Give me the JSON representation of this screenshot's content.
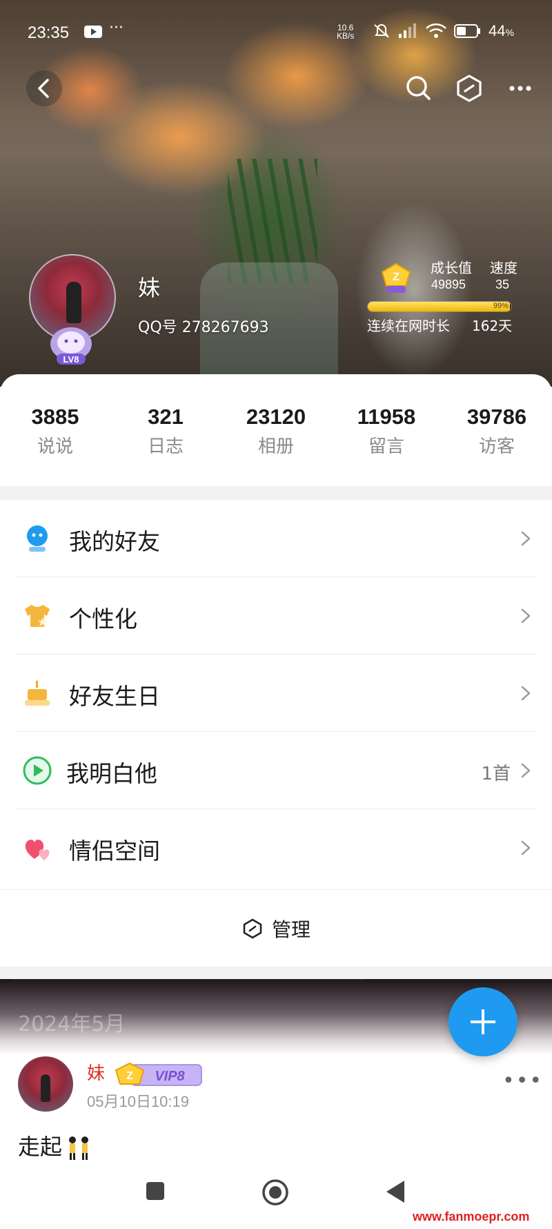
{
  "status_bar": {
    "time": "23:35",
    "network_speed_value": "10.6",
    "network_speed_unit": "KB/s",
    "battery": "44"
  },
  "profile": {
    "nickname": "妹",
    "qq_number": "QQ号 278267693",
    "level_badge": "LV8",
    "growth_label": "成长值",
    "speed_label": "速度",
    "growth_value": "49895",
    "speed_value": "35",
    "progress_percent": 99,
    "progress_text": "99%",
    "online_label": "连续在网时长",
    "online_days": "162天"
  },
  "stats": [
    {
      "value": "3885",
      "label": "说说"
    },
    {
      "value": "321",
      "label": "日志"
    },
    {
      "value": "23120",
      "label": "相册"
    },
    {
      "value": "11958",
      "label": "留言"
    },
    {
      "value": "39786",
      "label": "访客"
    }
  ],
  "menu": {
    "items": [
      {
        "label": "我的好友",
        "icon": "friends-icon",
        "extra": ""
      },
      {
        "label": "个性化",
        "icon": "tshirt-icon",
        "extra": ""
      },
      {
        "label": "好友生日",
        "icon": "cake-icon",
        "extra": ""
      },
      {
        "label": "我明白他",
        "icon": "play-icon",
        "extra": "1首"
      },
      {
        "label": "情侣空间",
        "icon": "hearts-icon",
        "extra": ""
      }
    ],
    "manage_label": "管理"
  },
  "feed": {
    "month": "2024年5月",
    "post": {
      "author": "妹",
      "vip_badge": "VIP8",
      "time": "05月10日10:19",
      "text": "走起"
    }
  },
  "watermark": "www.fanmoepr.com",
  "colors": {
    "accent": "#1e9bf0",
    "name_red": "#e03020",
    "progress_gold": "#f2b600"
  }
}
